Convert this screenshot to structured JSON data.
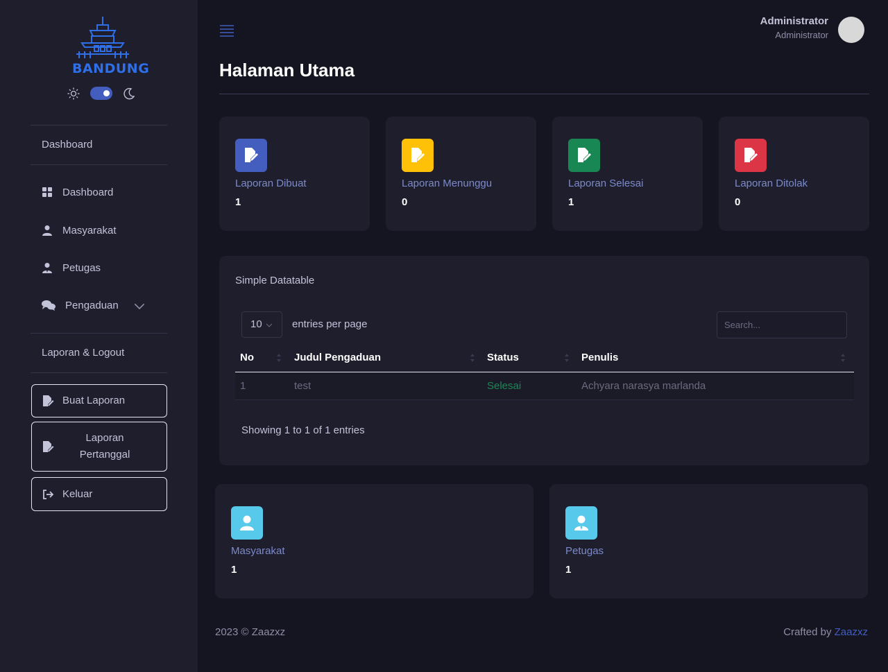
{
  "brand": {
    "logo_text": "BANDUNG"
  },
  "sidebar": {
    "section_dashboard": "Dashboard",
    "items": [
      {
        "label": "Dashboard",
        "icon": "grid-icon"
      },
      {
        "label": "Masyarakat",
        "icon": "user-icon"
      },
      {
        "label": "Petugas",
        "icon": "user-tie-icon"
      },
      {
        "label": "Pengaduan",
        "icon": "comments-icon"
      }
    ],
    "section_reports": "Laporan & Logout",
    "buttons": [
      {
        "label": "Buat Laporan",
        "icon": "file-edit-icon"
      },
      {
        "label_line1": "Laporan",
        "label_line2": "Pertanggal",
        "icon": "file-edit-icon"
      },
      {
        "label": "Keluar",
        "icon": "logout-icon"
      }
    ]
  },
  "header": {
    "user_name": "Administrator",
    "user_role": "Administrator",
    "page_title": "Halaman Utama"
  },
  "stats": [
    {
      "label": "Laporan Dibuat",
      "value": "1",
      "color": "#435ebe"
    },
    {
      "label": "Laporan Menunggu",
      "value": "0",
      "color": "#ffc107"
    },
    {
      "label": "Laporan Selesai",
      "value": "1",
      "color": "#198754"
    },
    {
      "label": "Laporan Ditolak",
      "value": "0",
      "color": "#dc3545"
    }
  ],
  "datatable": {
    "title": "Simple Datatable",
    "per_page": "10",
    "entries_label": "entries per page",
    "search_placeholder": "Search...",
    "columns": [
      "No",
      "Judul Pengaduan",
      "Status",
      "Penulis"
    ],
    "rows": [
      {
        "no": "1",
        "judul": "test",
        "status": "Selesai",
        "penulis": "Achyara narasya marlanda"
      }
    ],
    "info": "Showing 1 to 1 of 1 entries"
  },
  "users": [
    {
      "label": "Masyarakat",
      "value": "1",
      "color": "#57caeb"
    },
    {
      "label": "Petugas",
      "value": "1",
      "color": "#57caeb"
    }
  ],
  "footer": {
    "copyright": "2023 © Zaazxz",
    "crafted_prefix": "Crafted by ",
    "crafted_link": "Zaazxz"
  }
}
